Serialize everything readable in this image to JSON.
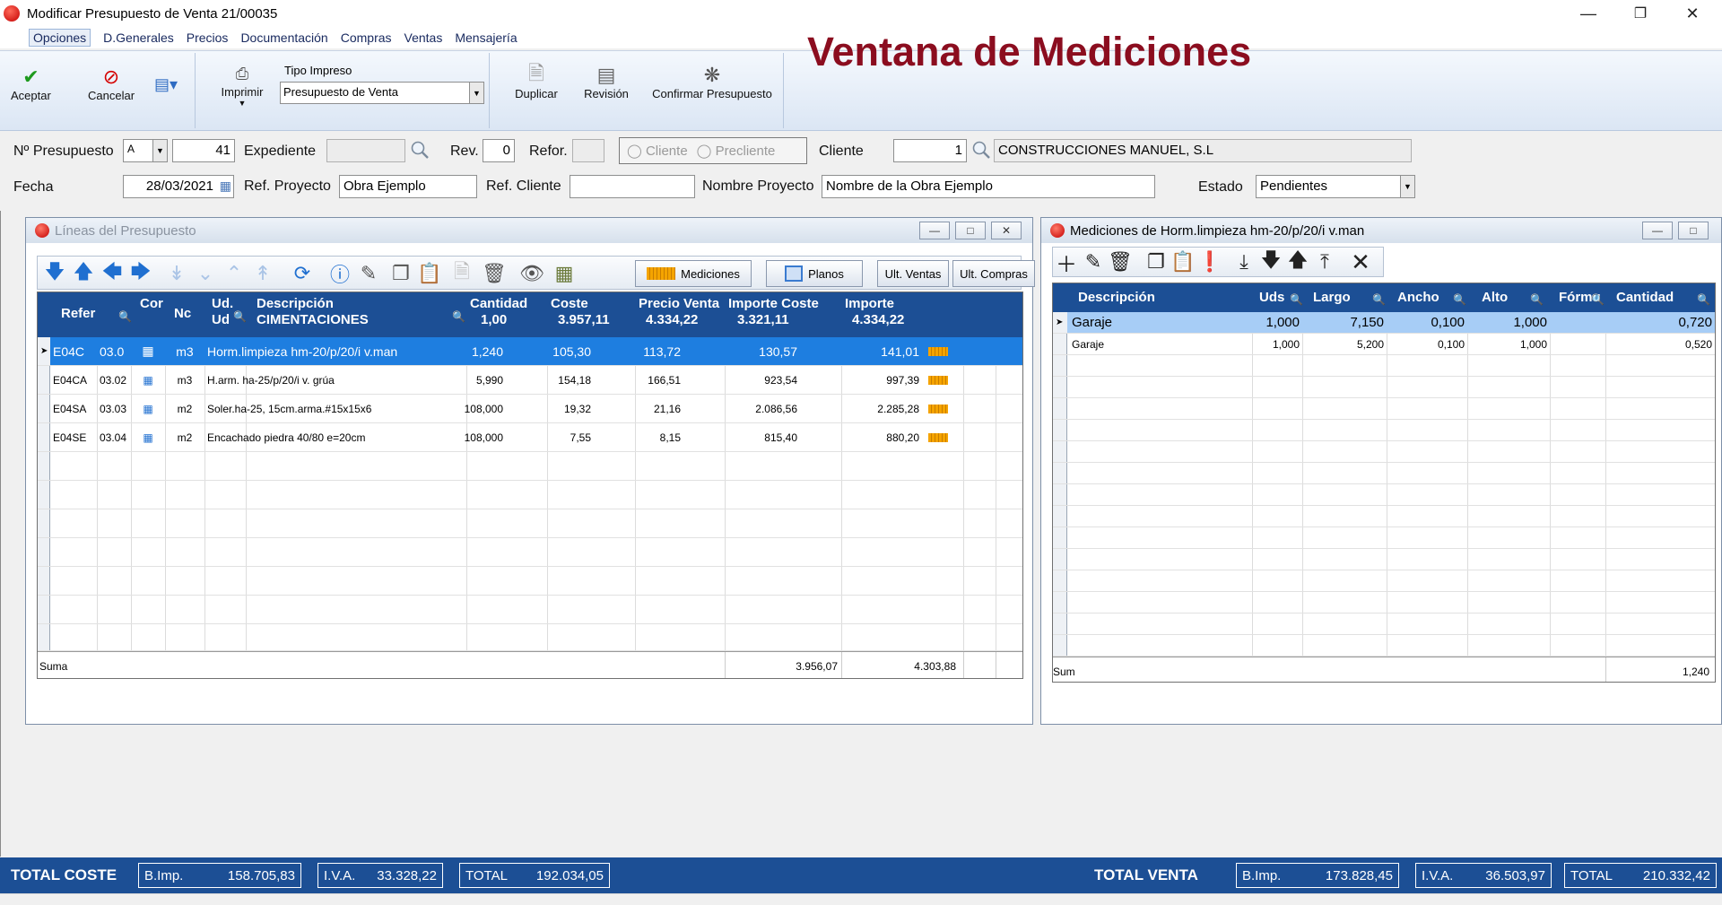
{
  "window": {
    "title": "Modificar Presupuesto de Venta 21/00035"
  },
  "menu": [
    "Opciones",
    "D.Generales",
    "Precios",
    "Documentación",
    "Compras",
    "Ventas",
    "Mensajería"
  ],
  "ribbon": {
    "accept": "Aceptar",
    "cancel": "Cancelar",
    "print": "Imprimir",
    "print_type_label": "Tipo Impreso",
    "print_type_value": "Presupuesto de Venta",
    "duplicate": "Duplicar",
    "revision": "Revisión",
    "confirm": "Confirmar Presupuesto"
  },
  "overlay_title": "Ventana de Mediciones",
  "header": {
    "num_label": "Nº Presupuesto",
    "serie": "A",
    "num": "41",
    "expediente_label": "Expediente",
    "expediente": "",
    "rev_label": "Rev.",
    "rev": "0",
    "refor_label": "Refor.",
    "refor": "",
    "radio_cliente": "Cliente",
    "radio_precliente": "Precliente",
    "cliente_label": "Cliente",
    "cliente_code": "1",
    "cliente_name": "CONSTRUCCIONES MANUEL, S.L",
    "fecha_label": "Fecha",
    "fecha": "28/03/2021",
    "ref_proyecto_label": "Ref. Proyecto",
    "ref_proyecto": "Obra Ejemplo",
    "ref_cliente_label": "Ref. Cliente",
    "ref_cliente": "",
    "nombre_proyecto_label": "Nombre Proyecto",
    "nombre_proyecto": "Nombre de la Obra Ejemplo",
    "estado_label": "Estado",
    "estado": "Pendientes"
  },
  "lineas": {
    "title": "Líneas del Presupuesto",
    "btn_mediciones": "Mediciones",
    "btn_planos": "Planos",
    "btn_ult_ventas": "Ult. Ventas",
    "btn_ult_compras": "Ult. Compras",
    "headers": {
      "refer": "Refer",
      "cor": "Cor",
      "nc": "Nc",
      "ud1": "Ud.",
      "ud2": "Ud",
      "desc1": "Descripción",
      "desc2": "CIMENTACIONES",
      "cantidad1": "Cantidad",
      "cantidad2": "1,00",
      "coste1": "Coste",
      "coste2": "3.957,11",
      "pventa1": "Precio Venta",
      "pventa2": "4.334,22",
      "icoste1": "Importe Coste",
      "icoste2": "3.321,11",
      "importe1": "Importe",
      "importe2": "4.334,22"
    },
    "rows": [
      {
        "ref": "E04C",
        "cor": "03.0",
        "ud": "m3",
        "desc": "Horm.limpieza hm-20/p/20/i  v.man",
        "cant": "1,240",
        "coste": "105,30",
        "pv": "113,72",
        "ic": "130,57",
        "imp": "141,01"
      },
      {
        "ref": "E04CA",
        "cor": "03.02",
        "ud": "m3",
        "desc": "H.arm. ha-25/p/20/i  v. grúa",
        "cant": "5,990",
        "coste": "154,18",
        "pv": "166,51",
        "ic": "923,54",
        "imp": "997,39"
      },
      {
        "ref": "E04SA",
        "cor": "03.03",
        "ud": "m2",
        "desc": "Soler.ha-25, 15cm.arma.#15x15x6",
        "cant": "108,000",
        "coste": "19,32",
        "pv": "21,16",
        "ic": "2.086,56",
        "imp": "2.285,28"
      },
      {
        "ref": "E04SE",
        "cor": "03.04",
        "ud": "m2",
        "desc": "Encachado piedra 40/80 e=20cm",
        "cant": "108,000",
        "coste": "7,55",
        "pv": "8,15",
        "ic": "815,40",
        "imp": "880,20"
      }
    ],
    "sum_label": "Suma",
    "sum_icoste": "3.956,07",
    "sum_importe": "4.303,88"
  },
  "mediciones": {
    "title": "Mediciones de Horm.limpieza hm-20/p/20/i  v.man",
    "headers": [
      "Descripción",
      "Uds",
      "Largo",
      "Ancho",
      "Alto",
      "Fórmu",
      "Cantidad"
    ],
    "rows": [
      [
        "Garaje",
        "1,000",
        "7,150",
        "0,100",
        "1,000",
        "",
        "0,720"
      ],
      [
        "Garaje",
        "1,000",
        "5,200",
        "0,100",
        "1,000",
        "",
        "0,520"
      ]
    ],
    "sum_label": "Sum",
    "sum_value": "1,240"
  },
  "totals": {
    "coste_label": "TOTAL COSTE",
    "coste_bimp_label": "B.Imp.",
    "coste_bimp": "158.705,83",
    "coste_iva_label": "I.V.A.",
    "coste_iva": "33.328,22",
    "coste_total_label": "TOTAL",
    "coste_total": "192.034,05",
    "venta_label": "TOTAL VENTA",
    "venta_bimp_label": "B.Imp.",
    "venta_bimp": "173.828,45",
    "venta_iva_label": "I.V.A.",
    "venta_iva": "36.503,97",
    "venta_total_label": "TOTAL",
    "venta_total": "210.332,42"
  }
}
